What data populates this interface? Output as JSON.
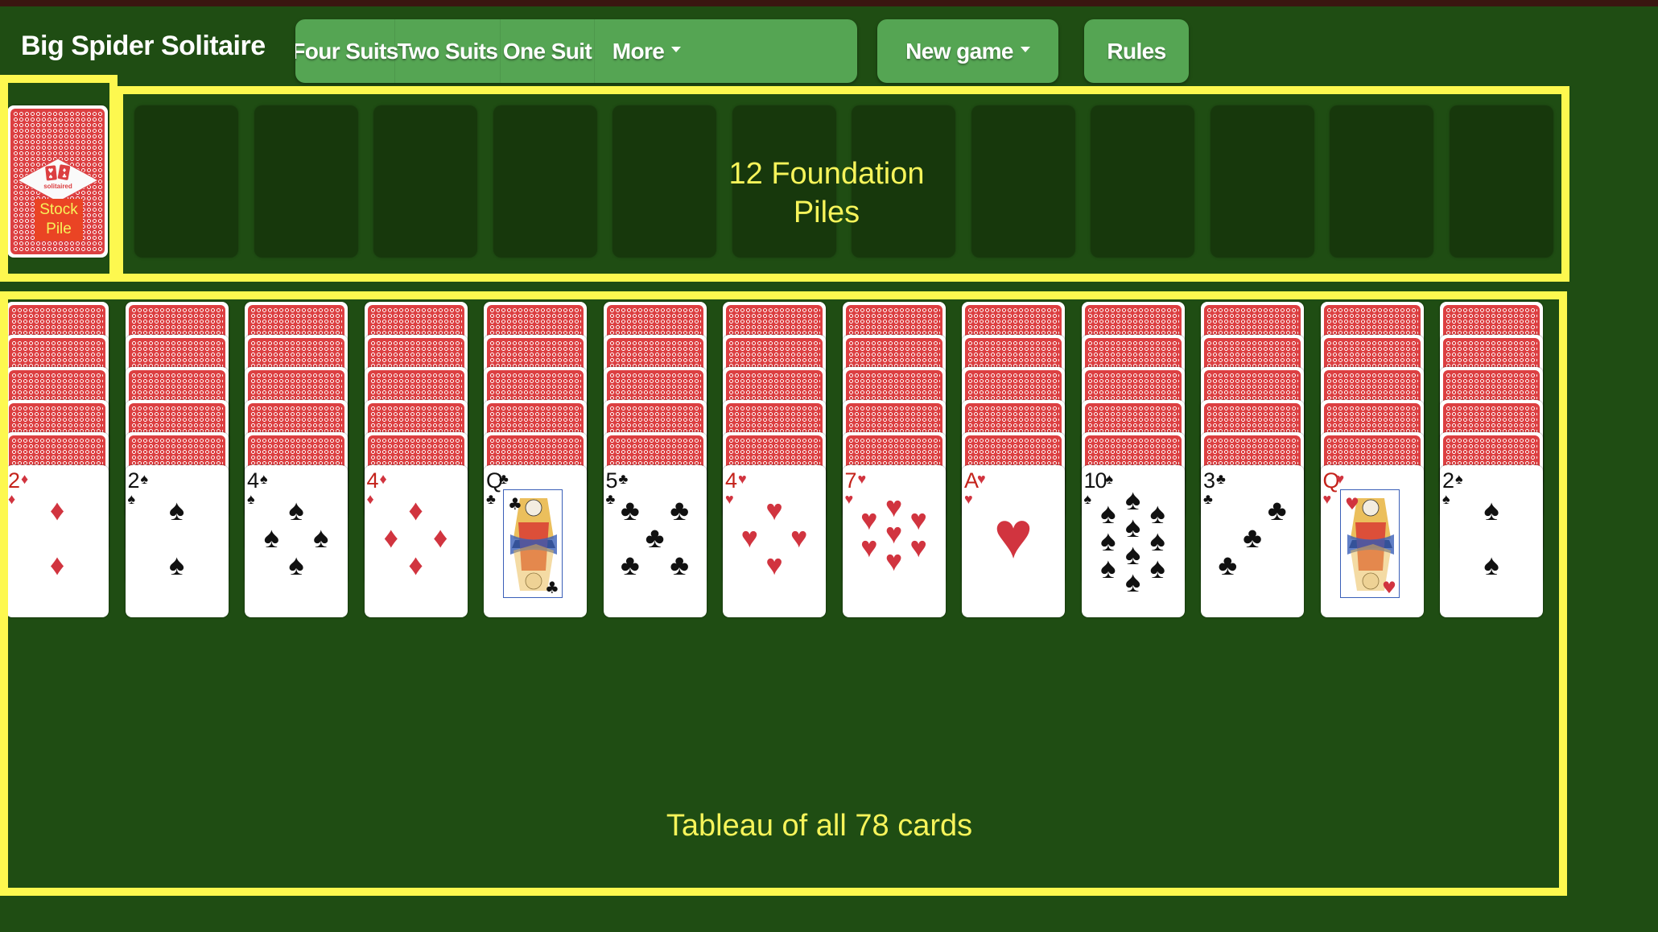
{
  "app": {
    "title": "Big Spider Solitaire"
  },
  "toolbar": {
    "variant_buttons": [
      {
        "label": "Four Suits"
      },
      {
        "label": "Two Suits"
      },
      {
        "label": "One Suit"
      },
      {
        "label": "More",
        "dropdown": true
      }
    ],
    "new_game": {
      "label": "New game",
      "dropdown": true
    },
    "rules": {
      "label": "Rules"
    }
  },
  "stock": {
    "label_line1": "Stock",
    "label_line2": "Pile",
    "brand": "solitaired",
    "face_down": true
  },
  "foundations": {
    "count": 12,
    "annotation_line1": "12 Foundation",
    "annotation_line2": "Piles",
    "slots": [
      "empty",
      "empty",
      "empty",
      "empty",
      "empty",
      "empty",
      "empty",
      "empty",
      "empty",
      "empty",
      "empty",
      "empty"
    ]
  },
  "tableau": {
    "annotation": "Tableau of all 78 cards",
    "face_down_per_column": 5,
    "columns": [
      {
        "rank": "2",
        "suit": "diamonds",
        "suit_symbol": "♦",
        "color": "red"
      },
      {
        "rank": "2",
        "suit": "spades",
        "suit_symbol": "♠",
        "color": "black"
      },
      {
        "rank": "4",
        "suit": "spades",
        "suit_symbol": "♠",
        "color": "black"
      },
      {
        "rank": "4",
        "suit": "diamonds",
        "suit_symbol": "♦",
        "color": "red"
      },
      {
        "rank": "Q",
        "suit": "clubs",
        "suit_symbol": "♣",
        "color": "black"
      },
      {
        "rank": "5",
        "suit": "clubs",
        "suit_symbol": "♣",
        "color": "black"
      },
      {
        "rank": "4",
        "suit": "hearts",
        "suit_symbol": "♥",
        "color": "red"
      },
      {
        "rank": "7",
        "suit": "hearts",
        "suit_symbol": "♥",
        "color": "red"
      },
      {
        "rank": "A",
        "suit": "hearts",
        "suit_symbol": "♥",
        "color": "red"
      },
      {
        "rank": "10",
        "suit": "spades",
        "suit_symbol": "♠",
        "color": "black"
      },
      {
        "rank": "3",
        "suit": "clubs",
        "suit_symbol": "♣",
        "color": "black"
      },
      {
        "rank": "Q",
        "suit": "hearts",
        "suit_symbol": "♥",
        "color": "red"
      },
      {
        "rank": "2",
        "suit": "spades",
        "suit_symbol": "♠",
        "color": "black"
      }
    ]
  },
  "colors": {
    "table_green": "#1f4d13",
    "button_green": "#55a553",
    "highlight_yellow": "#fdf84f",
    "annotation_yellow": "#f6f45a",
    "card_back_red": "#dc3f41",
    "stock_label_bg": "#ea4424"
  }
}
